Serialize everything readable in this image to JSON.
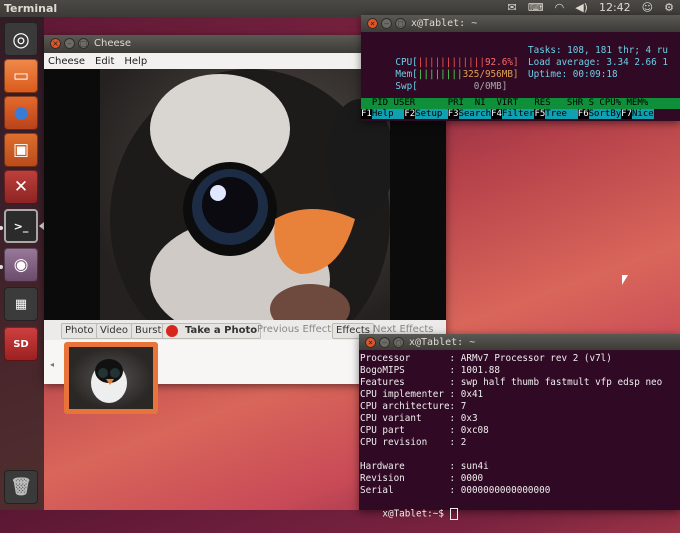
{
  "topbar": {
    "title": "Terminal",
    "clock": "12:42"
  },
  "launcher": {
    "items": [
      "ubuntu-dash",
      "files",
      "firefox",
      "software-center",
      "system-settings",
      "terminal",
      "cheese",
      "workspaces",
      "sd-card"
    ],
    "trash": "trash"
  },
  "cheese": {
    "title": "Cheese",
    "menu": [
      "Cheese",
      "Edit",
      "Help"
    ],
    "toolbar": {
      "photo": "Photo",
      "video": "Video",
      "burst": "Burst",
      "take": "Take a Photo",
      "prev": "Previous Effects",
      "effects": "Effects",
      "next": "Next Effects"
    }
  },
  "htop": {
    "title": "x@Tablet: ~",
    "cpu_label": "CPU[",
    "cpu_bar": "||||||||||||",
    "cpu_val": "92.6%]",
    "mem_label": "Mem[",
    "mem_bar": "||||||||",
    "mem_val": "325/956MB]",
    "swp_label": "Swp[",
    "swp_val": "0/0MB]",
    "tasks": "Tasks: 108, 181 thr; 4 ru",
    "load": "Load average: 3.34 2.66 1",
    "uptime": "Uptime: 00:09:18",
    "header": "  PID USER      PRI  NI  VIRT   RES   SHR S CPU% MEM%",
    "fkeys": [
      {
        "k": "F1",
        "l": "Help  "
      },
      {
        "k": "F2",
        "l": "Setup "
      },
      {
        "k": "F3",
        "l": "Search"
      },
      {
        "k": "F4",
        "l": "Filter"
      },
      {
        "k": "F5",
        "l": "Tree  "
      },
      {
        "k": "F6",
        "l": "SortBy"
      },
      {
        "k": "F7",
        "l": "Nice"
      }
    ]
  },
  "cpuinfo": {
    "title": "x@Tablet: ~",
    "lines": [
      "Processor       : ARMv7 Processor rev 2 (v7l)",
      "BogoMIPS        : 1001.88",
      "Features        : swp half thumb fastmult vfp edsp neo",
      "CPU implementer : 0x41",
      "CPU architecture: 7",
      "CPU variant     : 0x3",
      "CPU part        : 0xc08",
      "CPU revision    : 2",
      "",
      "Hardware        : sun4i",
      "Revision        : 0000",
      "Serial          : 0000000000000000"
    ],
    "prompt": "x@Tablet:~$ "
  }
}
